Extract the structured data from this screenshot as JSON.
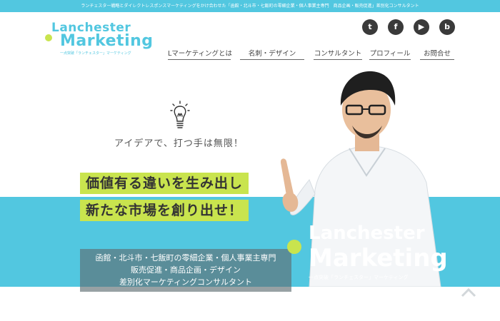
{
  "topbar": {
    "text": "ランチェスター戦略とダイレクトレスポンスマーケティングをかけ合わせた「函館・北斗市・七飯町の零細企業・個人事業主専門　商品企画・販売促進」差別化コンサルタント"
  },
  "logo": {
    "line1": "Lanchester",
    "line2": "Marketing",
    "tag": "一点突破「ランチェスター」マーケティング"
  },
  "social": [
    {
      "name": "twitter",
      "glyph": "t"
    },
    {
      "name": "facebook",
      "glyph": "f"
    },
    {
      "name": "youtube",
      "glyph": "▶"
    },
    {
      "name": "blog",
      "glyph": "b"
    }
  ],
  "nav": [
    {
      "label": "Lマーケティングとは"
    },
    {
      "label": "名刺・デザイン"
    },
    {
      "label": "コンサルタント"
    },
    {
      "label": "プロフィール"
    },
    {
      "label": "お問合せ"
    }
  ],
  "hero": {
    "tagline": "アイデアで、打つ手は無限！",
    "headline1": "価値有る違いを生み出し",
    "headline2": "新たな市場を創り出せ！",
    "info1": "函館・北斗市・七飯町の零細企業・個人事業主専門",
    "info2": "販売促進・商品企画・デザイン",
    "info3": "差別化マーケティングコンサルタント",
    "logo1": "Lanchester",
    "logo2": "Marketing",
    "logo_tag": "一点突破「ランチェスター」マーケティング"
  },
  "colors": {
    "accent": "#52c7e0",
    "highlight": "#c9e44e",
    "logo_mark": "#c9e44e"
  }
}
